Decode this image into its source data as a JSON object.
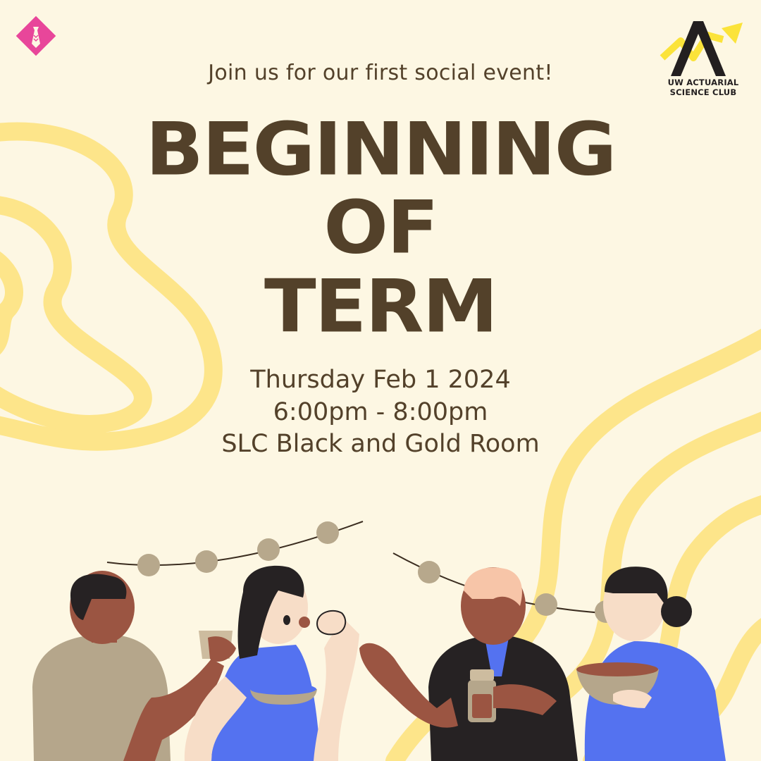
{
  "tagline": "Join us for our first social event!",
  "title": {
    "line1": "BEGINNING",
    "line2": "OF",
    "line3": "TERM"
  },
  "event": {
    "date": "Thursday Feb 1 2024",
    "time": "6:00pm - 8:00pm",
    "location": "SLC Black and Gold Room"
  },
  "club": {
    "line1": "UW ACTUARIAL",
    "line2": "SCIENCE CLUB"
  },
  "icons": {
    "left_logo": "pink-diamond-tie-icon",
    "club_logo": "letter-a-arrow-logo-icon"
  },
  "colors": {
    "background": "#fdf7e3",
    "swirl": "#fde58a",
    "text": "#53412a",
    "pink": "#e8469a",
    "blue": "#5472f0",
    "yellow": "#fbe33a"
  }
}
